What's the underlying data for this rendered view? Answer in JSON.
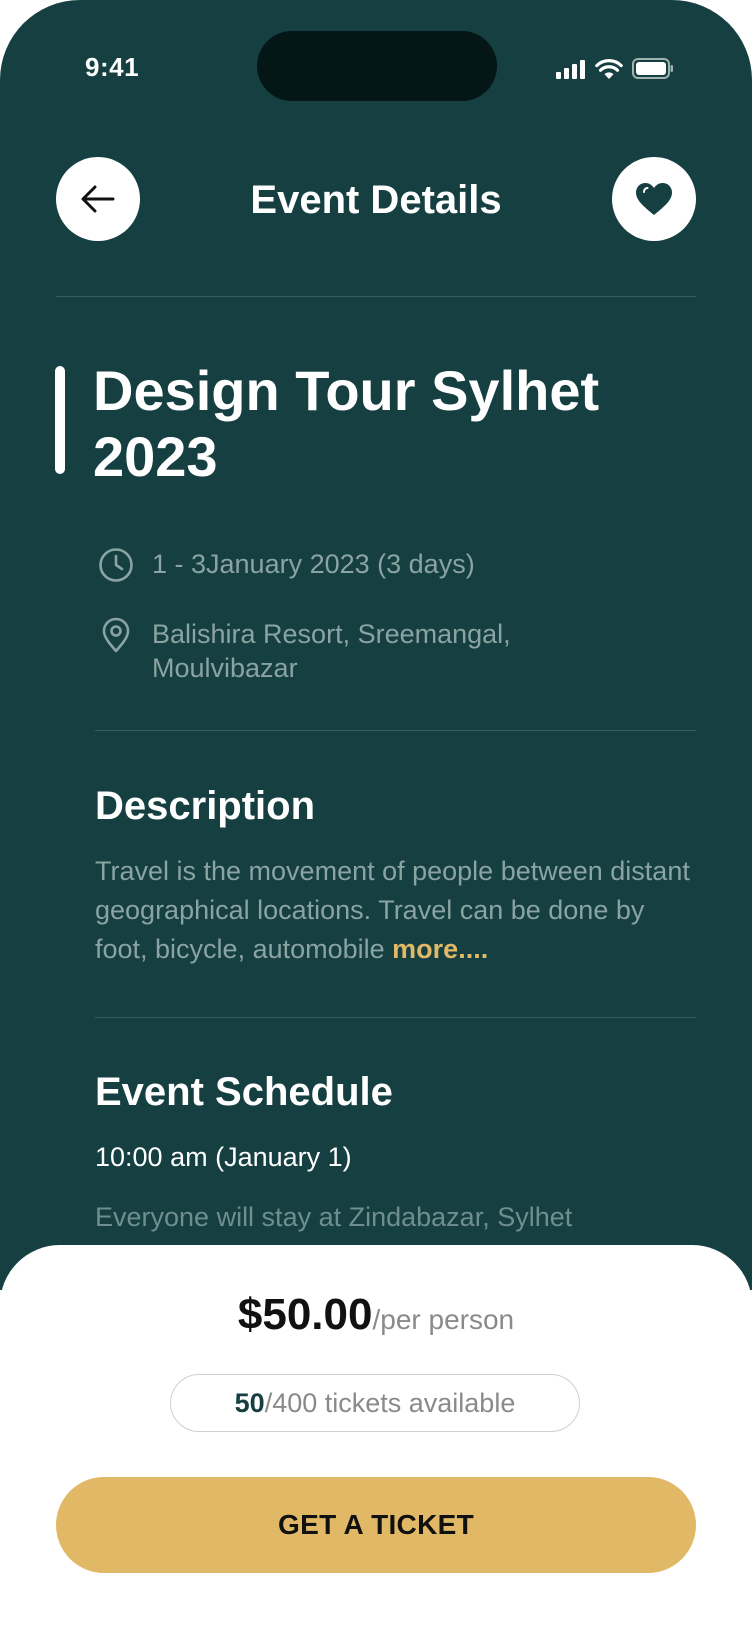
{
  "status_bar": {
    "time": "9:41"
  },
  "header": {
    "title": "Event Details"
  },
  "event": {
    "title": "Design Tour Sylhet 2023",
    "date": "1 - 3January 2023 (3 days)",
    "location": "Balishira Resort, Sreemangal, Moulvibazar"
  },
  "description": {
    "title": "Description",
    "text": "Travel is the movement of people between distant geographical locations. Travel can be done by foot, bicycle, automobile ",
    "more_label": "more...."
  },
  "schedule": {
    "title": "Event Schedule",
    "time": "10:00 am (January 1)",
    "item": "Everyone will stay at Zindabazar, Sylhet"
  },
  "booking": {
    "price": "$50.00",
    "per_label": "/per person",
    "tickets_available": "50",
    "tickets_total": "/400 tickets available",
    "cta_label": "GET A TICKET"
  },
  "colors": {
    "primary": "#153f40",
    "accent": "#e1b966",
    "muted_text": "#8aa3a3"
  },
  "icons": {
    "back": "arrow-left-icon",
    "favorite": "heart-icon",
    "date": "clock-icon",
    "location": "map-pin-icon"
  }
}
